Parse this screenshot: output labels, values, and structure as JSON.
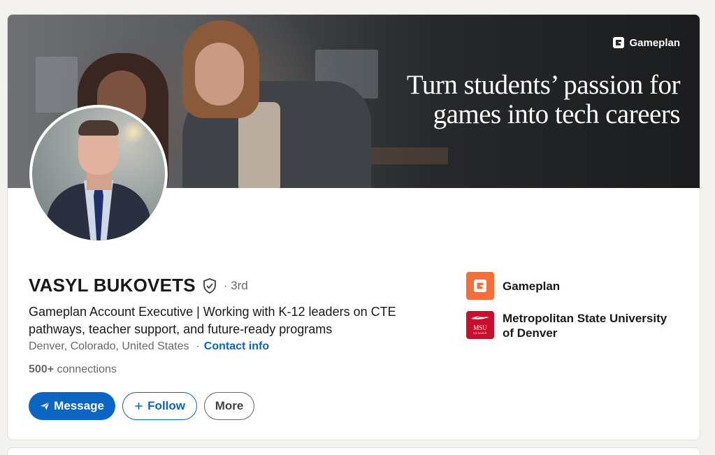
{
  "banner": {
    "brand": "Gameplan",
    "tagline_line1": "Turn students’ passion for",
    "tagline_line2": "games into tech careers"
  },
  "profile": {
    "name": "VASYL BUKOVETS",
    "degree": "· 3rd",
    "headline": "Gameplan Account Executive | Working with K-12 leaders on CTE pathways, teacher support, and future-ready programs",
    "location": "Denver, Colorado, United States",
    "location_separator": "·",
    "contact_label": "Contact info",
    "connections_count": "500+",
    "connections_label": "connections"
  },
  "actions": {
    "message": "Message",
    "follow": "Follow",
    "more": "More"
  },
  "organizations": [
    {
      "name": "Gameplan",
      "logo": "gameplan-logo"
    },
    {
      "name": "Metropolitan State University of Denver",
      "logo_text_top": "MSU",
      "logo_text_bottom": "DENVER"
    }
  ],
  "colors": {
    "accent": "#0a66c2",
    "gameplan_orange": "#f26f3a",
    "msu_red": "#c8102e",
    "page_bg": "#f4f2ee"
  }
}
